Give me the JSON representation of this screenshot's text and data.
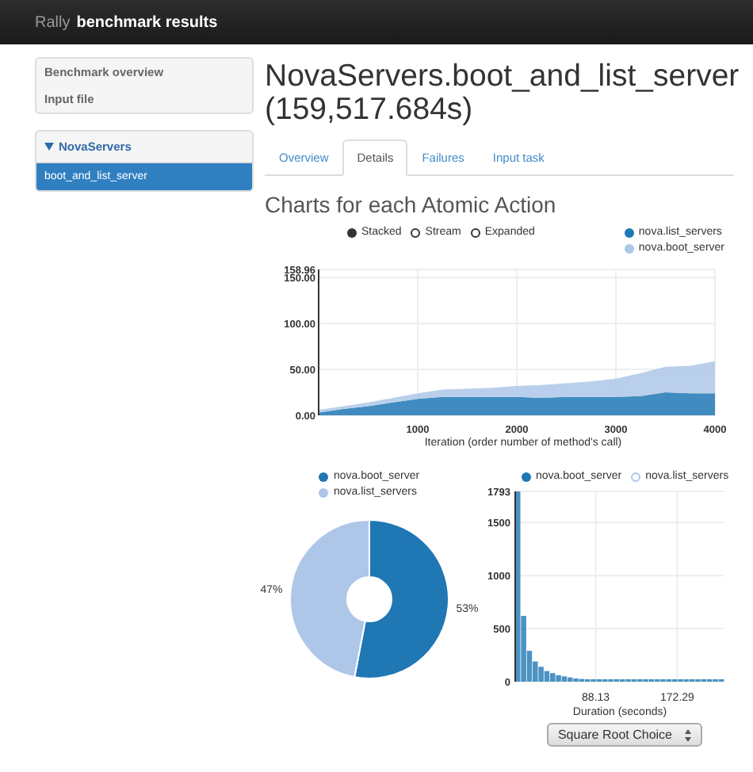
{
  "header": {
    "brand": "Rally",
    "title": "benchmark results"
  },
  "sidebar": {
    "links": [
      {
        "label": "Benchmark overview",
        "selected": false
      },
      {
        "label": "Input file",
        "selected": false
      }
    ],
    "group": {
      "label": "NovaServers",
      "expanded": true,
      "items": [
        {
          "label": "boot_and_list_server",
          "selected": true
        }
      ]
    }
  },
  "page": {
    "title": "NovaServers.boot_and_list_server (159,517.684s)",
    "tabs": [
      {
        "label": "Overview",
        "selected": false
      },
      {
        "label": "Details",
        "selected": true
      },
      {
        "label": "Failures",
        "selected": false
      },
      {
        "label": "Input task",
        "selected": false
      }
    ],
    "section_title": "Charts for each Atomic Action"
  },
  "area_chart": {
    "modes": [
      {
        "label": "Stacked",
        "selected": true
      },
      {
        "label": "Stream",
        "selected": false
      },
      {
        "label": "Expanded",
        "selected": false
      }
    ],
    "chart_data": {
      "type": "area",
      "stacked": true,
      "xlabel": "Iteration (order number of method's call)",
      "x": [
        0,
        250,
        500,
        750,
        1000,
        1250,
        1500,
        1750,
        2000,
        2250,
        2500,
        2750,
        3000,
        3250,
        3500,
        3750,
        4000
      ],
      "grid": true,
      "series": [
        {
          "name": "nova.list_servers",
          "color": "#1f77b4",
          "values": [
            3,
            7,
            10,
            14,
            18,
            20,
            20,
            20,
            20,
            19,
            20,
            20,
            20,
            21,
            25,
            24,
            24
          ]
        },
        {
          "name": "nova.boot_server",
          "color": "#aec7e8",
          "values": [
            3,
            3,
            4,
            5,
            6,
            8,
            9,
            10,
            12,
            14,
            15,
            17,
            20,
            25,
            28,
            30,
            35
          ]
        }
      ],
      "xlim": [
        0,
        4000
      ],
      "ylim": [
        0,
        158.96
      ],
      "xticks": [
        1000,
        2000,
        3000,
        4000
      ],
      "yticks": [
        {
          "value": 0,
          "label": "0.00"
        },
        {
          "value": 50,
          "label": "50.00"
        },
        {
          "value": 100,
          "label": "100.00"
        },
        {
          "value": 150,
          "label": "150.00"
        },
        {
          "value": 158.96,
          "label": "158.96"
        }
      ]
    }
  },
  "pie_chart": {
    "legend": [
      {
        "label": "nova.boot_server",
        "color": "#1f77b4"
      },
      {
        "label": "nova.list_servers",
        "color": "#aec7e8"
      }
    ],
    "chart_data": {
      "type": "donut",
      "values": [
        53,
        47
      ],
      "value_labels": [
        "53%",
        "47%"
      ]
    }
  },
  "histogram": {
    "legend": [
      {
        "label": "nova.boot_server",
        "color": "#1f77b4",
        "selected": true
      },
      {
        "label": "nova.list_servers",
        "color": "#aec7e8",
        "selected": false
      }
    ],
    "chart_data": {
      "type": "bar",
      "xlabel": "Duration (seconds)",
      "x": [
        5,
        11,
        17,
        23,
        29,
        35,
        41,
        47,
        53,
        59,
        65,
        71,
        77,
        83,
        89,
        95,
        101,
        107,
        113,
        119,
        125,
        131,
        137,
        143,
        149,
        155,
        161,
        167,
        173,
        179,
        185,
        191,
        197,
        203,
        209,
        215
      ],
      "grid": true,
      "values": [
        1793,
        620,
        290,
        190,
        140,
        100,
        80,
        60,
        50,
        40,
        30,
        25,
        20,
        20,
        15,
        10,
        10,
        10,
        10,
        5,
        5,
        5,
        5,
        5,
        5,
        5,
        5,
        5,
        5,
        5,
        5,
        5,
        5,
        5,
        5,
        5
      ],
      "xlim": [
        5,
        221
      ],
      "ylim": [
        0,
        1793
      ],
      "xticks": [
        {
          "value": 88.13,
          "label": "88.13"
        },
        {
          "value": 172.29,
          "label": "172.29"
        }
      ],
      "yticks": [
        0,
        500,
        1000,
        1500,
        1793
      ]
    },
    "scale_select": {
      "value": "Square Root Choice"
    }
  }
}
